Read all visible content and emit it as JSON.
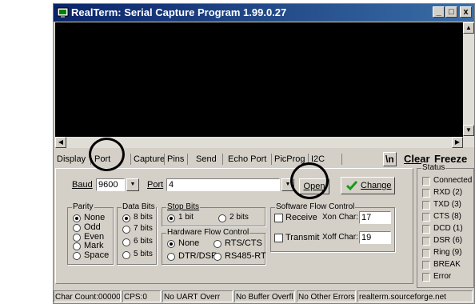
{
  "window": {
    "title": "RealTerm: Serial Capture Program 1.99.0.27"
  },
  "tabs": [
    {
      "label": "Display"
    },
    {
      "label": "Port"
    },
    {
      "label": "Capture"
    },
    {
      "label": "Pins"
    },
    {
      "label": "Send"
    },
    {
      "label": "Echo Port"
    },
    {
      "label": "PicProg"
    },
    {
      "label": "I2C"
    }
  ],
  "toolbar": {
    "newline_label": "\\n",
    "clear_label": "Clear",
    "freeze_label": "Freeze"
  },
  "port": {
    "baud_label": "Baud",
    "baud_value": "9600",
    "port_label": "Port",
    "port_value": "4",
    "open_label": "Open",
    "change_label": "Change"
  },
  "parity": {
    "label": "Parity",
    "options": [
      "None",
      "Odd",
      "Even",
      "Mark",
      "Space"
    ],
    "selected": "None"
  },
  "data_bits": {
    "label": "Data Bits",
    "options": [
      "8 bits",
      "7 bits",
      "6 bits",
      "5 bits"
    ],
    "selected": "8 bits"
  },
  "stop_bits": {
    "label": "Stop Bits",
    "options": [
      "1 bit",
      "2 bits"
    ],
    "selected": "1 bit"
  },
  "hw_flow": {
    "label": "Hardware Flow Control",
    "options": [
      "None",
      "RTS/CTS",
      "DTR/DSR",
      "RS485-RT"
    ],
    "selected": "None"
  },
  "sw_flow": {
    "label": "Software Flow Control",
    "receive_label": "Receive",
    "transmit_label": "Transmit",
    "xon_label": "Xon Char:",
    "xon_value": "17",
    "xoff_label": "Xoff Char:",
    "xoff_value": "19"
  },
  "status": {
    "label": "Status",
    "items": [
      "Connected",
      "RXD (2)",
      "TXD (3)",
      "CTS (8)",
      "DCD (1)",
      "DSR (6)",
      "Ring (9)",
      "BREAK",
      "Error"
    ]
  },
  "statusbar": {
    "char_count": "Char Count:0000000",
    "cps": "CPS:0",
    "uart": "No UART Overr",
    "buffer": "No Buffer Overfl",
    "other": "No Other Errors",
    "site": "realterm.sourceforge.net"
  },
  "colors": {
    "titlebar_start": "#0a246a",
    "titlebar_end": "#3a6ea5",
    "chrome": "#d4d0c8",
    "terminal": "#000000",
    "change_check": "#1a9a1a"
  }
}
